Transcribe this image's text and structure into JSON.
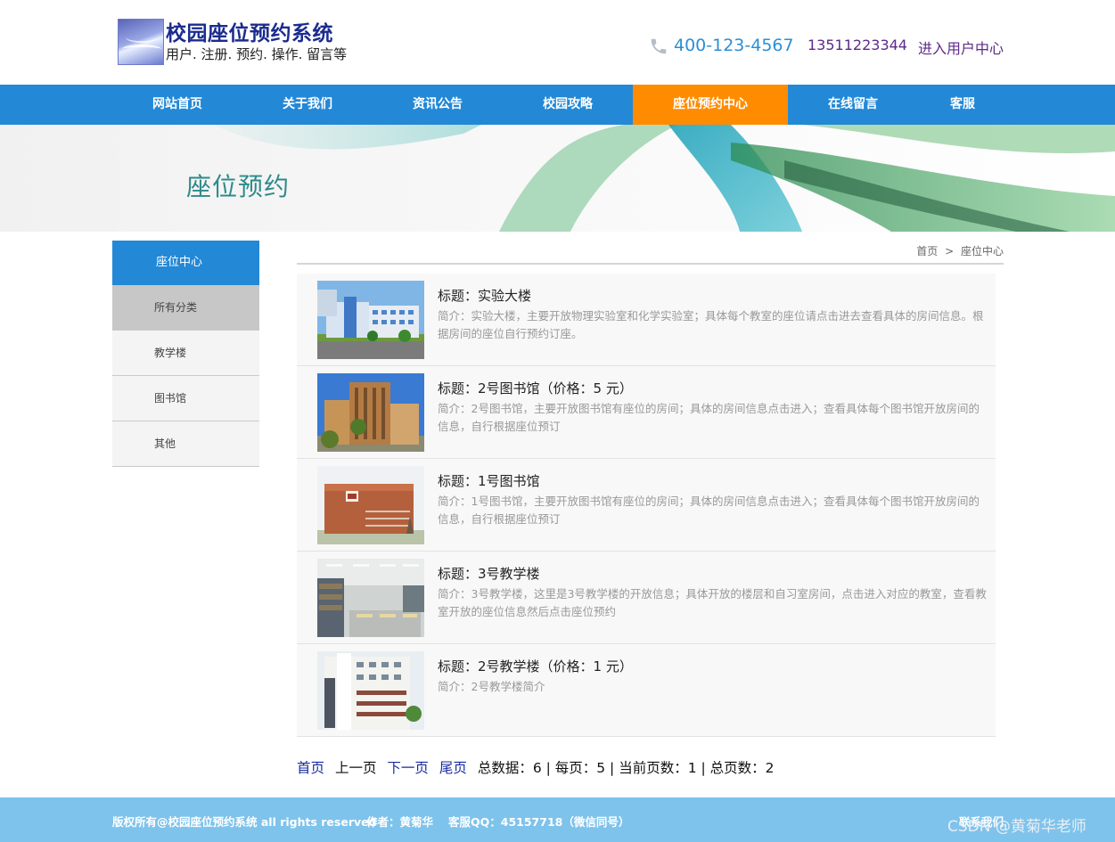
{
  "header": {
    "title": "校园座位预约系统",
    "subtitle": "用户. 注册. 预约. 操作. 留言等",
    "phone": "400-123-4567",
    "mobile": "13511223344",
    "enter_link": "进入用户中心"
  },
  "nav": {
    "items": [
      "网站首页",
      "关于我们",
      "资讯公告",
      "校园攻略",
      "座位预约中心",
      "在线留言",
      "客服"
    ],
    "active": "座位预约中心"
  },
  "banner": {
    "title": "座位预约"
  },
  "sidebar": {
    "heading": "座位中心",
    "items": [
      "所有分类",
      "教学楼",
      "图书馆",
      "其他"
    ],
    "active": "所有分类"
  },
  "breadcrumb": {
    "home": "首页",
    "separator": ">",
    "current": "座位中心"
  },
  "list": [
    {
      "title": "标题：实验大楼",
      "desc": "简介：实验大楼，主要开放物理实验室和化学实验室；具体每个教室的座位请点击进去查看具体的房间信息。根据房间的座位自行预约订座。"
    },
    {
      "title": "标题：2号图书馆（价格：5 元）",
      "desc": "简介：2号图书馆，主要开放图书馆有座位的房间；具体的房间信息点击进入；查看具体每个图书馆开放房间的信息，自行根据座位预订"
    },
    {
      "title": "标题：1号图书馆",
      "desc": "简介：1号图书馆，主要开放图书馆有座位的房间；具体的房间信息点击进入；查看具体每个图书馆开放房间的信息，自行根据座位预订"
    },
    {
      "title": "标题：3号教学楼",
      "desc": "简介：3号教学楼，这里是3号教学楼的开放信息；具体开放的楼层和自习室房间，点击进入对应的教室，查看教室开放的座位信息然后点击座位预约"
    },
    {
      "title": "标题：2号教学楼（价格：1 元）",
      "desc": "简介：2号教学楼简介"
    }
  ],
  "pager": {
    "first": "首页",
    "prev": "上一页",
    "next": "下一页",
    "last": "尾页",
    "stats": "总数据：6 | 每页：5 | 当前页数：1 | 总页数：2"
  },
  "footer": {
    "copyright": "版权所有@校园座位预约系统 all rights reserved",
    "author": "作者：黄菊华",
    "qq": "客服QQ：45157718（微信同号）",
    "contact": "联系我们"
  },
  "watermark": "CSDN @黄菊华老师",
  "colors": {
    "nav": "#2388d6",
    "active": "#ff8c00",
    "footer": "#7ec3ec"
  }
}
